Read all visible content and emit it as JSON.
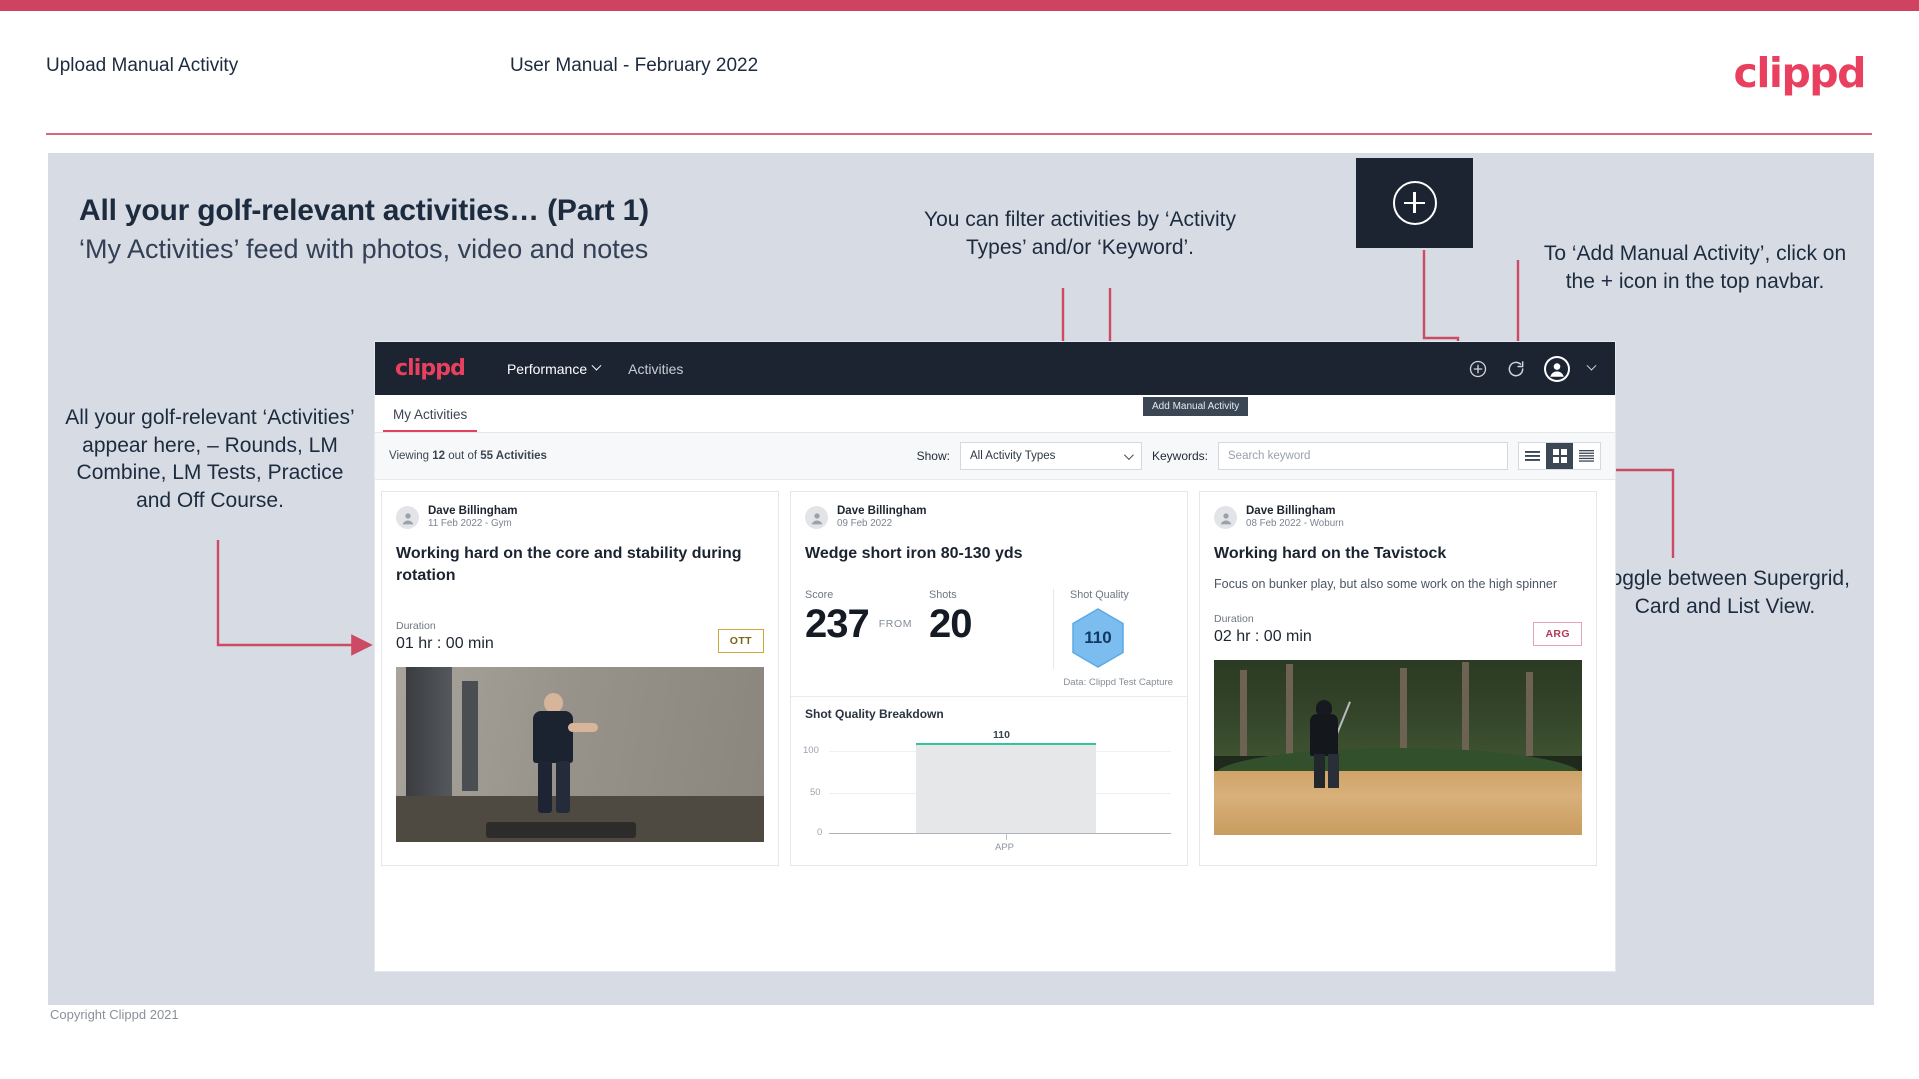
{
  "header": {
    "left_title": "Upload Manual Activity",
    "center_title": "User Manual - February 2022",
    "brand": "clippd"
  },
  "slide": {
    "heading": "All your golf-relevant activities… (Part 1)",
    "subheading": "‘My Activities’ feed with photos, video and notes",
    "copyright": "Copyright Clippd 2021"
  },
  "annotations": {
    "filter": "You can filter activities by ‘Activity Types’ and/or ‘Keyword’.",
    "add_manual": "To ‘Add Manual Activity’, click on the + icon in the top navbar.",
    "activities_feed": "All your golf-relevant ‘Activities’ appear here, – Rounds, LM Combine, LM Tests, Practice and Off Course.",
    "toggle_views": "Toggle between Supergrid, Card and List View."
  },
  "app": {
    "navbar": {
      "logo": "clippd",
      "links": [
        {
          "label": "Performance",
          "icon": "chevron-down-icon",
          "active": true
        },
        {
          "label": "Activities",
          "icon": "",
          "active": false
        }
      ],
      "icons": [
        "plus-circle-icon",
        "refresh-icon",
        "avatar-icon",
        "chevron-down-icon"
      ],
      "tooltip": "Add Manual Activity"
    },
    "tabs": [
      {
        "label": "My Activities",
        "active": true
      }
    ],
    "filterbar": {
      "viewing_prefix": "Viewing ",
      "viewing_count": "12",
      "viewing_mid": " out of ",
      "viewing_total": "55 Activities",
      "show_label": "Show:",
      "activity_type_value": "All Activity Types",
      "keywords_label": "Keywords:",
      "keyword_placeholder": "Search keyword",
      "view_modes": [
        "list-view-icon",
        "supergrid-view-icon",
        "card-view-icon"
      ],
      "active_view": "supergrid-view-icon"
    },
    "cards": [
      {
        "author": "Dave Billingham",
        "meta": "11 Feb 2022 - Gym",
        "title": "Working hard on the core and stability during rotation",
        "note": "",
        "duration_label": "Duration",
        "duration_value": "01 hr : 00 min",
        "chip": "OTT",
        "media": "gym-video-thumbnail"
      },
      {
        "author": "Dave Billingham",
        "meta": "09 Feb 2022",
        "title": "Wedge short iron 80-130 yds",
        "note": "",
        "metrics": {
          "score_label": "Score",
          "score_value": "237",
          "from_label": "FROM",
          "shots_label": "Shots",
          "shots_value": "20",
          "quality_label": "Shot Quality",
          "quality_value": "110"
        },
        "data_source": "Data: Clippd Test Capture",
        "breakdown_title": "Shot Quality Breakdown"
      },
      {
        "author": "Dave Billingham",
        "meta": "08 Feb 2022 - Woburn",
        "title": "Working hard on the Tavistock",
        "note": "Focus on bunker play, but also some work on the high spinner",
        "duration_label": "Duration",
        "duration_value": "02 hr : 00 min",
        "chip": "ARG",
        "media": "bunker-photo-thumbnail"
      }
    ]
  },
  "chart_data": {
    "type": "bar",
    "title": "Shot Quality Breakdown",
    "categories": [
      "APP"
    ],
    "values": [
      110
    ],
    "data_labels": [
      "110"
    ],
    "ylabel": "",
    "xlabel": "",
    "yticks": [
      0,
      50,
      100
    ],
    "ytick_labels": [
      "0",
      "50",
      "100"
    ],
    "ylim": [
      0,
      125
    ],
    "grid": true,
    "legend": "none",
    "bar_color": "#e6e7e8",
    "cap_color": "#35c49a"
  },
  "colors": {
    "accent_red": "#cf4360",
    "brand_pink": "#ea4060",
    "panel_bg": "#d7dce4",
    "navy": "#1b2430",
    "arrow": "#cc4a63"
  }
}
